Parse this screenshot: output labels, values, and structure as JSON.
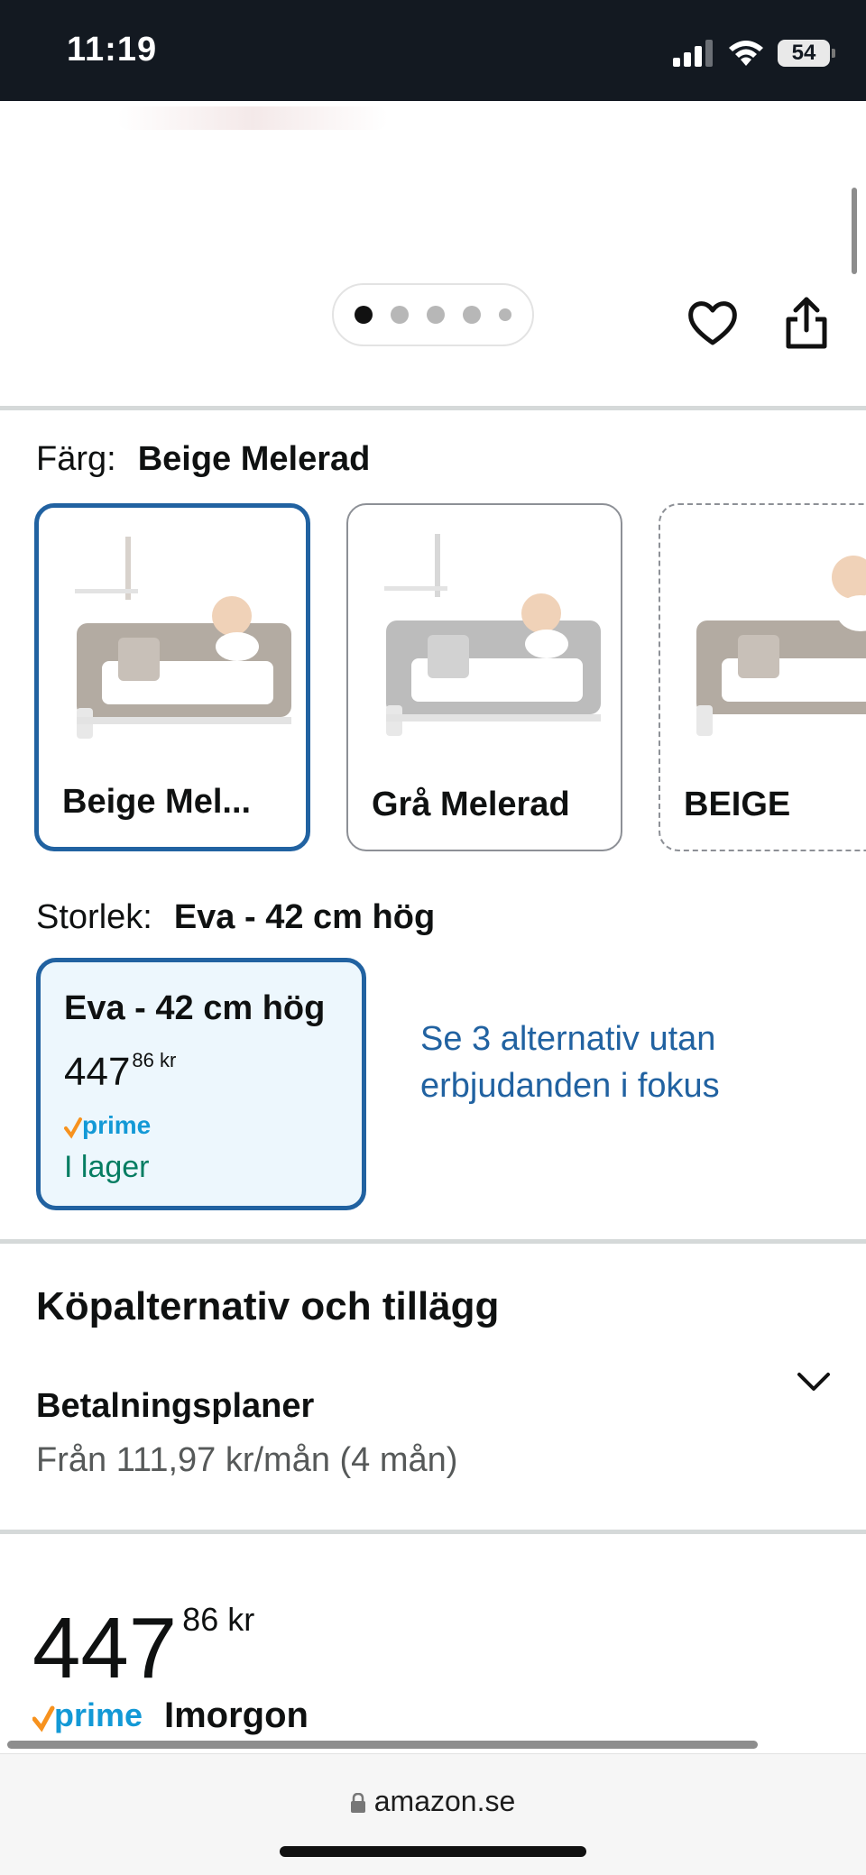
{
  "status_bar": {
    "time": "11:19",
    "battery": "54"
  },
  "carousel": {
    "dot_count": 5,
    "active_index": 0
  },
  "color": {
    "label": "Färg:",
    "selected": "Beige Melerad",
    "options": [
      {
        "label": "Beige Mel...",
        "frame_color": "#b3aba2"
      },
      {
        "label": "Grå Melerad",
        "frame_color": "#bcbcbc"
      },
      {
        "label": "BEIGE",
        "frame_color": "#b3aba2"
      }
    ]
  },
  "size": {
    "label": "Storlek:",
    "selected": "Eva - 42 cm hög",
    "card": {
      "name": "Eva - 42 cm hög",
      "price_whole": "447",
      "price_fraction": "86 kr",
      "prime": "prime",
      "stock": "I lager"
    },
    "see_options": "Se 3 alternativ utan erbjudanden i fokus"
  },
  "buying_options": {
    "title": "Köpalternativ och tillägg",
    "payment_plans_title": "Betalningsplaner",
    "payment_plans_sub": "Från 111,97 kr/mån (4 mån)"
  },
  "price": {
    "whole": "447",
    "fraction": "86 kr"
  },
  "delivery": {
    "prime": "prime",
    "text": "Imorgon"
  },
  "browser": {
    "url": "amazon.se"
  },
  "colors": {
    "link": "#2162a1",
    "selected_border": "#2162a1",
    "stock_green": "#067d62",
    "prime_blue": "#1399d6",
    "prime_check": "#f7921e"
  }
}
